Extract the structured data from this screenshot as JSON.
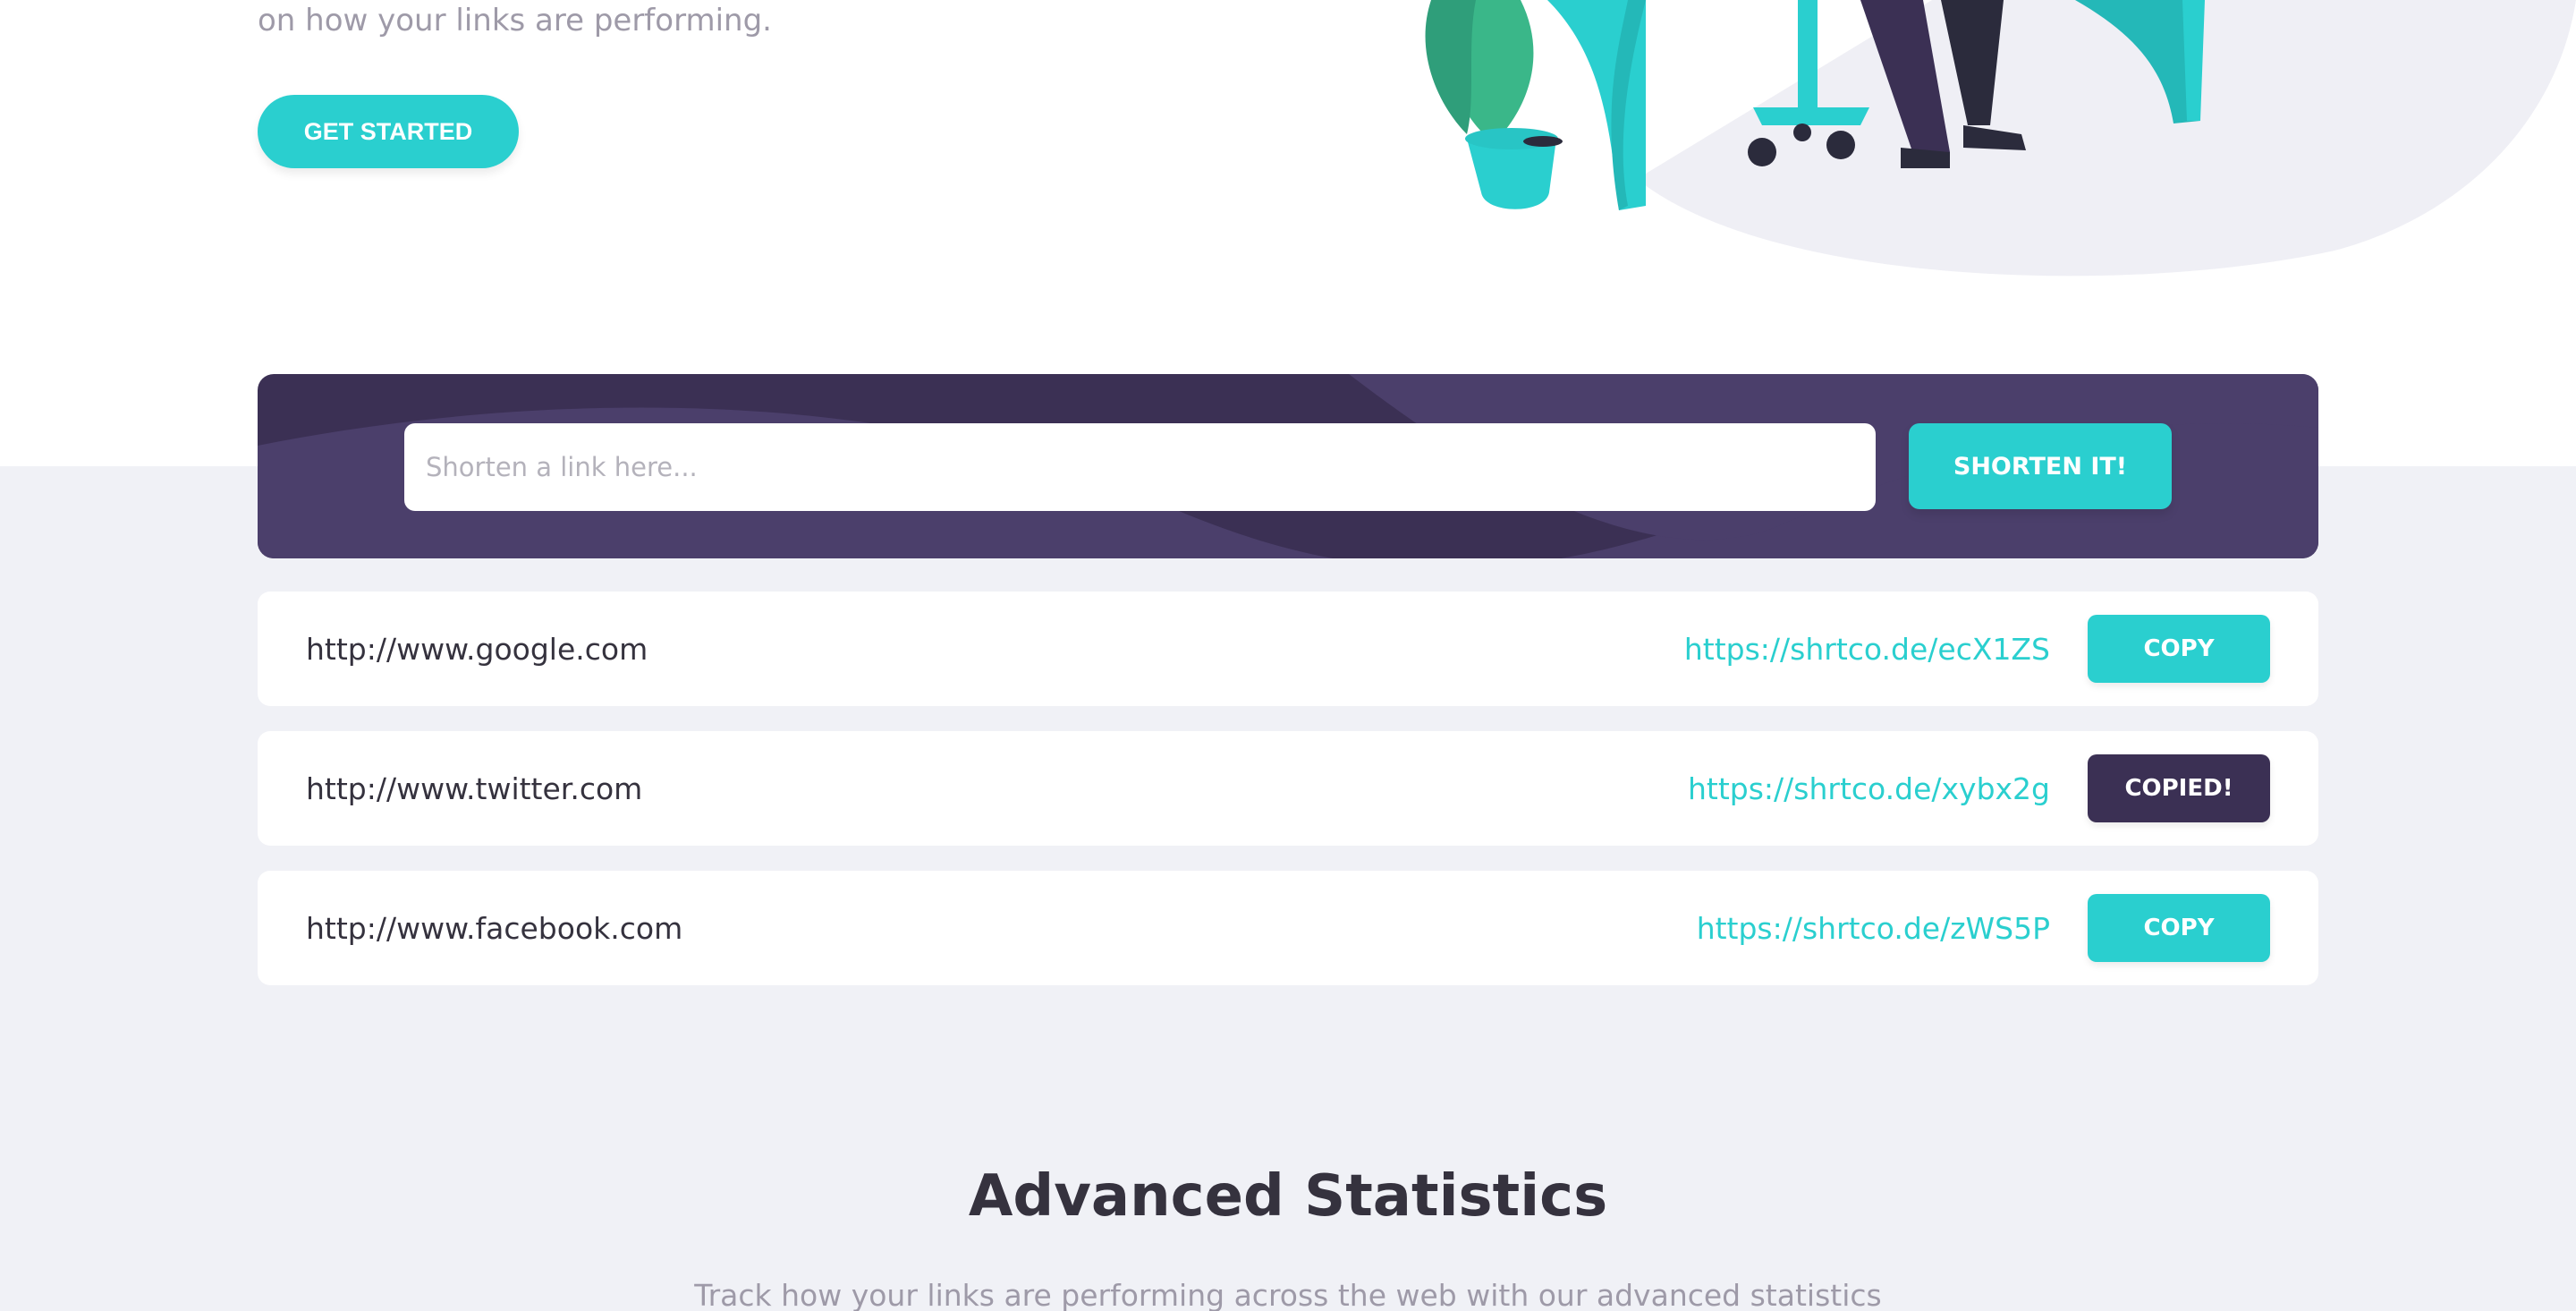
{
  "hero": {
    "text": "on how your links are performing.",
    "cta_label": "GET STARTED"
  },
  "shortener": {
    "placeholder": "Shorten a link here...",
    "button_label": "SHORTEN IT!"
  },
  "links": [
    {
      "original": "http://www.google.com",
      "short": "https://shrtco.de/ecX1ZS",
      "button": "COPY"
    },
    {
      "original": "http://www.twitter.com",
      "short": "https://shrtco.de/xybx2g",
      "button": "COPIED!"
    },
    {
      "original": "http://www.facebook.com",
      "short": "https://shrtco.de/zWS5P",
      "button": "COPY"
    }
  ],
  "statistics": {
    "title": "Advanced Statistics",
    "subtitle": "Track how your links are performing across the web with our advanced statistics"
  },
  "colors": {
    "accent": "#2acfcf",
    "dark_violet": "#3b3054",
    "background_gray": "#f0f1f6"
  }
}
